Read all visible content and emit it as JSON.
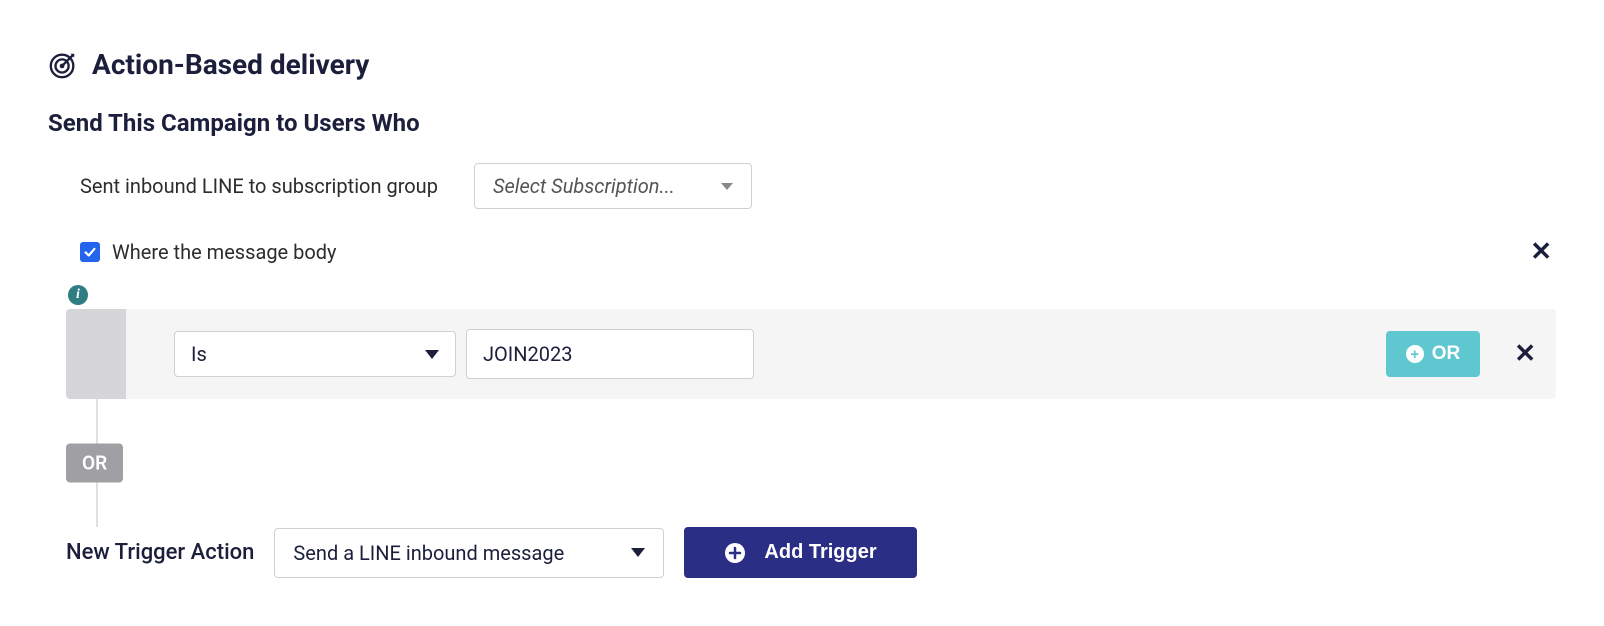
{
  "header": {
    "title": "Action-Based delivery"
  },
  "subtitle": "Send This Campaign to Users Who",
  "inbound": {
    "label": "Sent inbound LINE to subscription group",
    "subscription_placeholder": "Select Subscription..."
  },
  "message_body": {
    "checkbox_checked": true,
    "label": "Where the message body"
  },
  "rule": {
    "operator": "Is",
    "value": "JOIN2023",
    "or_button": "OR"
  },
  "connector": {
    "label": "OR"
  },
  "new_trigger": {
    "label": "New Trigger Action",
    "selected": "Send a LINE inbound message",
    "button": "Add Trigger"
  }
}
